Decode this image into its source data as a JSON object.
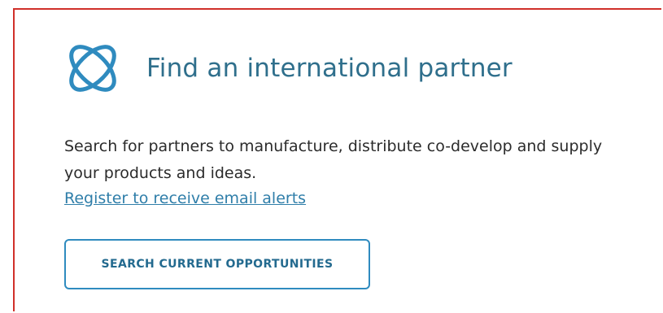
{
  "card": {
    "logo_icon": "orbit-globe-icon",
    "title": "Find an international partner",
    "description": "Search for partners to manufacture, distribute co-develop and supply your products and ideas.",
    "link_text": "Register to receive email alerts",
    "button_label": "SEARCH CURRENT OPPORTUNITIES"
  },
  "colors": {
    "border": "#d0302a",
    "title": "#2f6f8c",
    "logo": "#2f8bbf",
    "link": "#2f7ea9",
    "button_border": "#2f8bbf",
    "button_text": "#236a8f"
  }
}
